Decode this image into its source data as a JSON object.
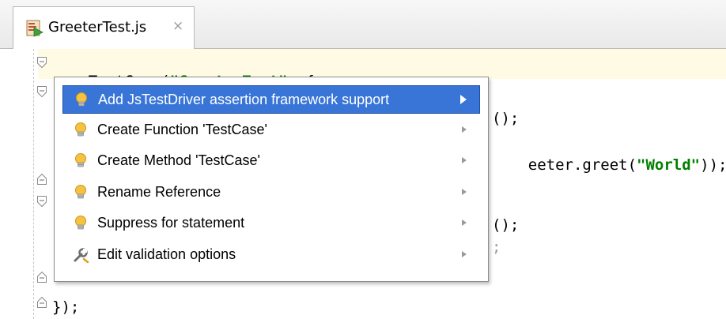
{
  "tab": {
    "title": "GreeterTest.js",
    "close_glyph": "×",
    "icon": "js-test-file-icon"
  },
  "code": {
    "line1": {
      "id": "TestCase",
      "open": "(",
      "str": "\"GreeterTest\"",
      "rest": ", {"
    },
    "line3_tail": "();",
    "line4_tail": {
      "pre": "eeter.greet(",
      "str": "\"World\"",
      "post": "));"
    },
    "line7_tail": "();",
    "line8_tail": ";",
    "line10": "});"
  },
  "popup": {
    "items": [
      {
        "label": "Add JsTestDriver assertion framework support",
        "icon": "lightbulb-icon",
        "selected": true
      },
      {
        "label": "Create Function 'TestCase'",
        "icon": "lightbulb-icon",
        "selected": false
      },
      {
        "label": "Create Method 'TestCase'",
        "icon": "lightbulb-icon",
        "selected": false
      },
      {
        "label": "Rename Reference",
        "icon": "lightbulb-icon",
        "selected": false
      },
      {
        "label": "Suppress for statement",
        "icon": "lightbulb-icon",
        "selected": false
      },
      {
        "label": "Edit validation options",
        "icon": "wrench-icon",
        "selected": false
      }
    ]
  },
  "colors": {
    "selection": "#3875d7",
    "current_line": "#fffae3",
    "string": "#008000",
    "bulb": "#f5c242"
  }
}
